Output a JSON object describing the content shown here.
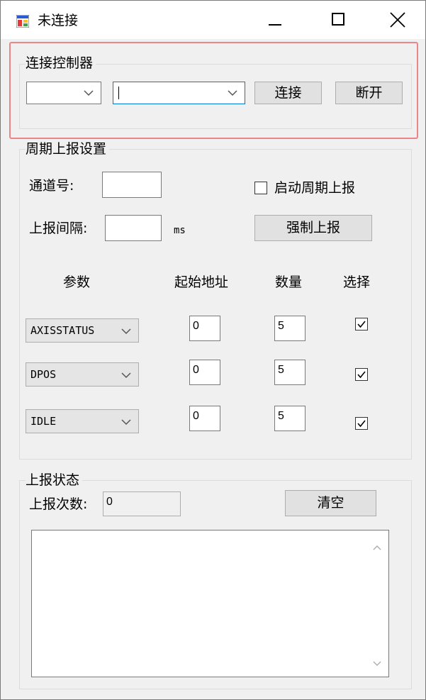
{
  "window": {
    "title": "未连接"
  },
  "connect": {
    "group_label": "连接控制器",
    "type_value": "",
    "address_value": "",
    "connect_label": "连接",
    "disconnect_label": "断开"
  },
  "periodic": {
    "group_label": "周期上报设置",
    "channel_label": "通道号:",
    "channel_value": "",
    "enable_label": "启动周期上报",
    "enable_checked": false,
    "interval_label": "上报间隔:",
    "interval_value": "",
    "interval_unit": "ms",
    "force_label": "强制上报",
    "headers": {
      "param": "参数",
      "start": "起始地址",
      "count": "数量",
      "select": "选择"
    },
    "rows": [
      {
        "param": "AXISSTATUS",
        "start": "0",
        "count": "5",
        "checked": true
      },
      {
        "param": "DPOS",
        "start": "0",
        "count": "5",
        "checked": true
      },
      {
        "param": "IDLE",
        "start": "0",
        "count": "5",
        "checked": true
      }
    ]
  },
  "status": {
    "group_label": "上报状态",
    "count_label": "上报次数:",
    "count_value": "0",
    "clear_label": "清空",
    "log_text": ""
  }
}
